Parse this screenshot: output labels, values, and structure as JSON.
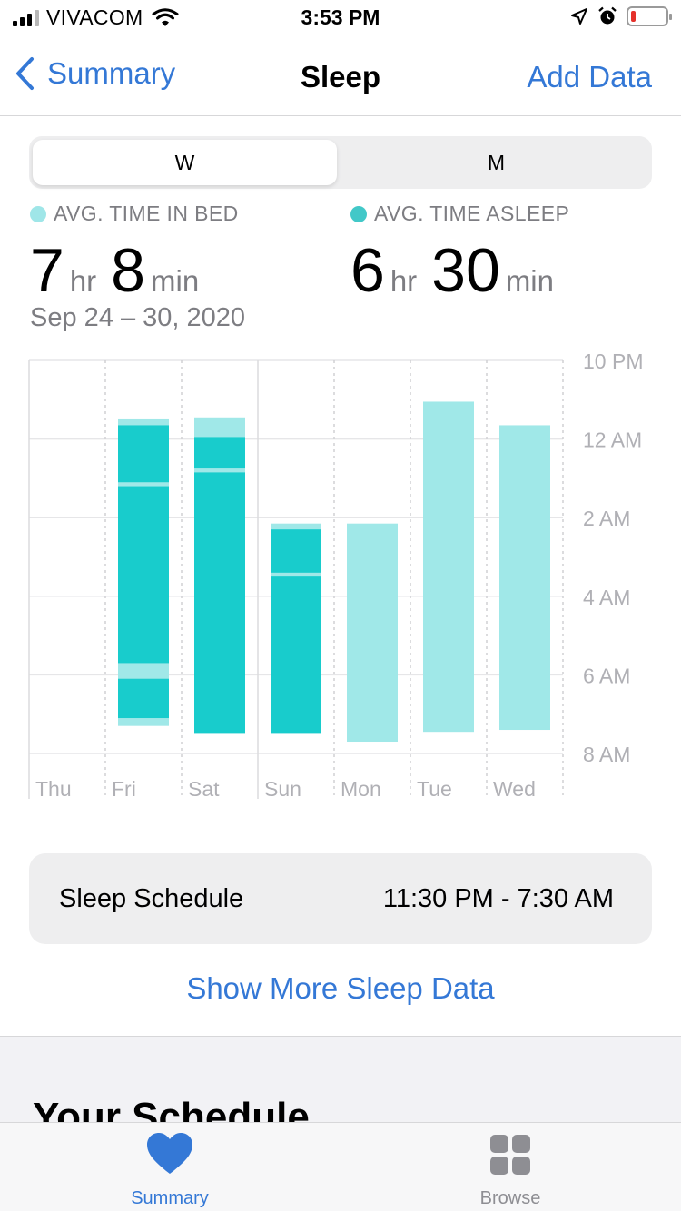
{
  "status_bar": {
    "carrier": "VIVACOM",
    "time": "3:53 PM",
    "icons": [
      "signal-icon",
      "wifi-icon",
      "location-icon",
      "alarm-icon",
      "battery-icon"
    ]
  },
  "nav": {
    "back_label": "Summary",
    "title": "Sleep",
    "action_label": "Add Data"
  },
  "segments": {
    "week": "W",
    "month": "M",
    "selected": "W"
  },
  "stats": {
    "time_in_bed": {
      "label": "AVG. TIME IN BED",
      "hours": "7",
      "hours_unit": "hr",
      "minutes": "8",
      "minutes_unit": "min",
      "color": "#9fe6e8"
    },
    "time_asleep": {
      "label": "AVG. TIME ASLEEP",
      "hours": "6",
      "hours_unit": "hr",
      "minutes": "30",
      "minutes_unit": "min",
      "color": "#42c8c8"
    }
  },
  "date_range": "Sep 24 – 30, 2020",
  "chart_data": {
    "type": "bar",
    "categories": [
      "Thu",
      "Fri",
      "Sat",
      "Sun",
      "Mon",
      "Tue",
      "Wed"
    ],
    "y_ticks": [
      "10 PM",
      "12 AM",
      "2 AM",
      "4 AM",
      "6 AM",
      "8 AM"
    ],
    "ylim_hours_after_10pm": [
      0,
      10
    ],
    "colors": {
      "in_bed": "#a0e8e8",
      "asleep": "#18cccc"
    },
    "series": [
      {
        "name": "In Bed",
        "values": [
          null,
          [
            1.5,
            9.3
          ],
          [
            1.45,
            9.5
          ],
          [
            4.15,
            9.5
          ],
          [
            4.15,
            9.7
          ],
          [
            1.05,
            9.45
          ],
          [
            1.65,
            9.4
          ]
        ]
      },
      {
        "name": "Asleep",
        "values": [
          null,
          [
            [
              1.65,
              3.1
            ],
            [
              3.2,
              7.7
            ],
            [
              8.1,
              9.1
            ]
          ],
          [
            [
              1.95,
              2.75
            ],
            [
              2.85,
              9.5
            ]
          ],
          [
            [
              4.3,
              5.4
            ],
            [
              5.5,
              9.5
            ]
          ],
          null,
          null,
          null
        ]
      }
    ]
  },
  "schedule": {
    "label": "Sleep Schedule",
    "value": "11:30 PM - 7:30 AM"
  },
  "more_link": "Show More Sleep Data",
  "next_section_heading": "Your Schedule",
  "tabbar": {
    "summary": {
      "label": "Summary",
      "icon": "heart-icon",
      "color": "#3478d6"
    },
    "browse": {
      "label": "Browse",
      "icon": "grid-icon"
    }
  }
}
